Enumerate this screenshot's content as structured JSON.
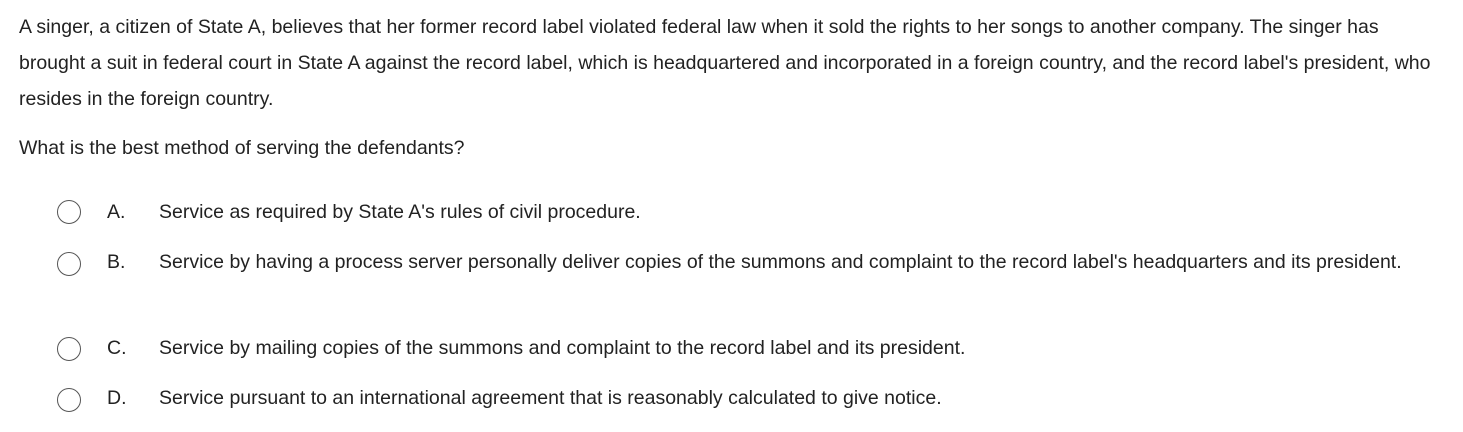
{
  "question": {
    "stem": "A singer, a citizen of State A, believes that her former record label violated federal law when it sold the rights to her songs to another company. The singer has brought a suit in federal court in State A against the record label, which is headquartered and incorporated in a foreign country, and the record label's president, who resides in the foreign country.",
    "prompt": "What is the best method of serving the defendants?"
  },
  "choices": [
    {
      "letter": "A.",
      "text": "Service as required by State A's rules of civil procedure."
    },
    {
      "letter": "B.",
      "text": "Service by having a process server personally deliver copies of the summons and complaint to the record label's headquarters and its president."
    },
    {
      "letter": "C.",
      "text": "Service by mailing copies of the summons and complaint to the record label and its president."
    },
    {
      "letter": "D.",
      "text": "Service pursuant to an international agreement that is reasonably calculated to give notice."
    }
  ]
}
